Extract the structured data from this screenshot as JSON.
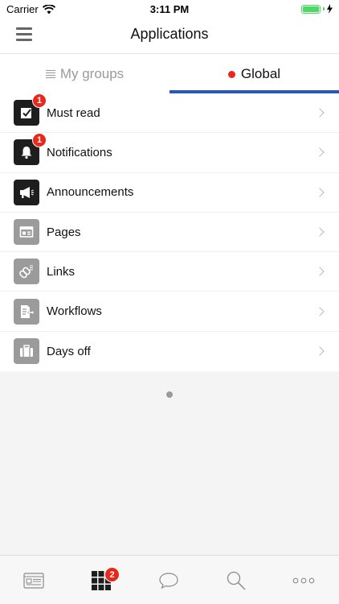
{
  "status_bar": {
    "carrier": "Carrier",
    "time": "3:11 PM"
  },
  "header": {
    "title": "Applications"
  },
  "tabs": [
    {
      "label": "My groups",
      "active": false
    },
    {
      "label": "Global",
      "active": true
    }
  ],
  "apps": [
    {
      "label": "Must read",
      "icon": "checkbox-icon",
      "badge": "1",
      "style": "dark"
    },
    {
      "label": "Notifications",
      "icon": "bell-icon",
      "badge": "1",
      "style": "dark"
    },
    {
      "label": "Announcements",
      "icon": "megaphone-icon",
      "badge": "",
      "style": "dark"
    },
    {
      "label": "Pages",
      "icon": "page-layout-icon",
      "badge": "",
      "style": "gray"
    },
    {
      "label": "Links",
      "icon": "link-icon",
      "badge": "",
      "style": "gray"
    },
    {
      "label": "Workflows",
      "icon": "workflow-document-icon",
      "badge": "",
      "style": "gray"
    },
    {
      "label": "Days off",
      "icon": "suitcase-icon",
      "badge": "",
      "style": "gray"
    }
  ],
  "tabbar": {
    "items": [
      {
        "icon": "newsfeed-icon"
      },
      {
        "icon": "apps-grid-icon",
        "badge": "2"
      },
      {
        "icon": "chat-bubble-icon"
      },
      {
        "icon": "search-icon"
      },
      {
        "icon": "more-icon"
      }
    ]
  },
  "colors": {
    "accent": "#2a56b5",
    "badge": "#e8281a",
    "battery": "#4cd964"
  }
}
